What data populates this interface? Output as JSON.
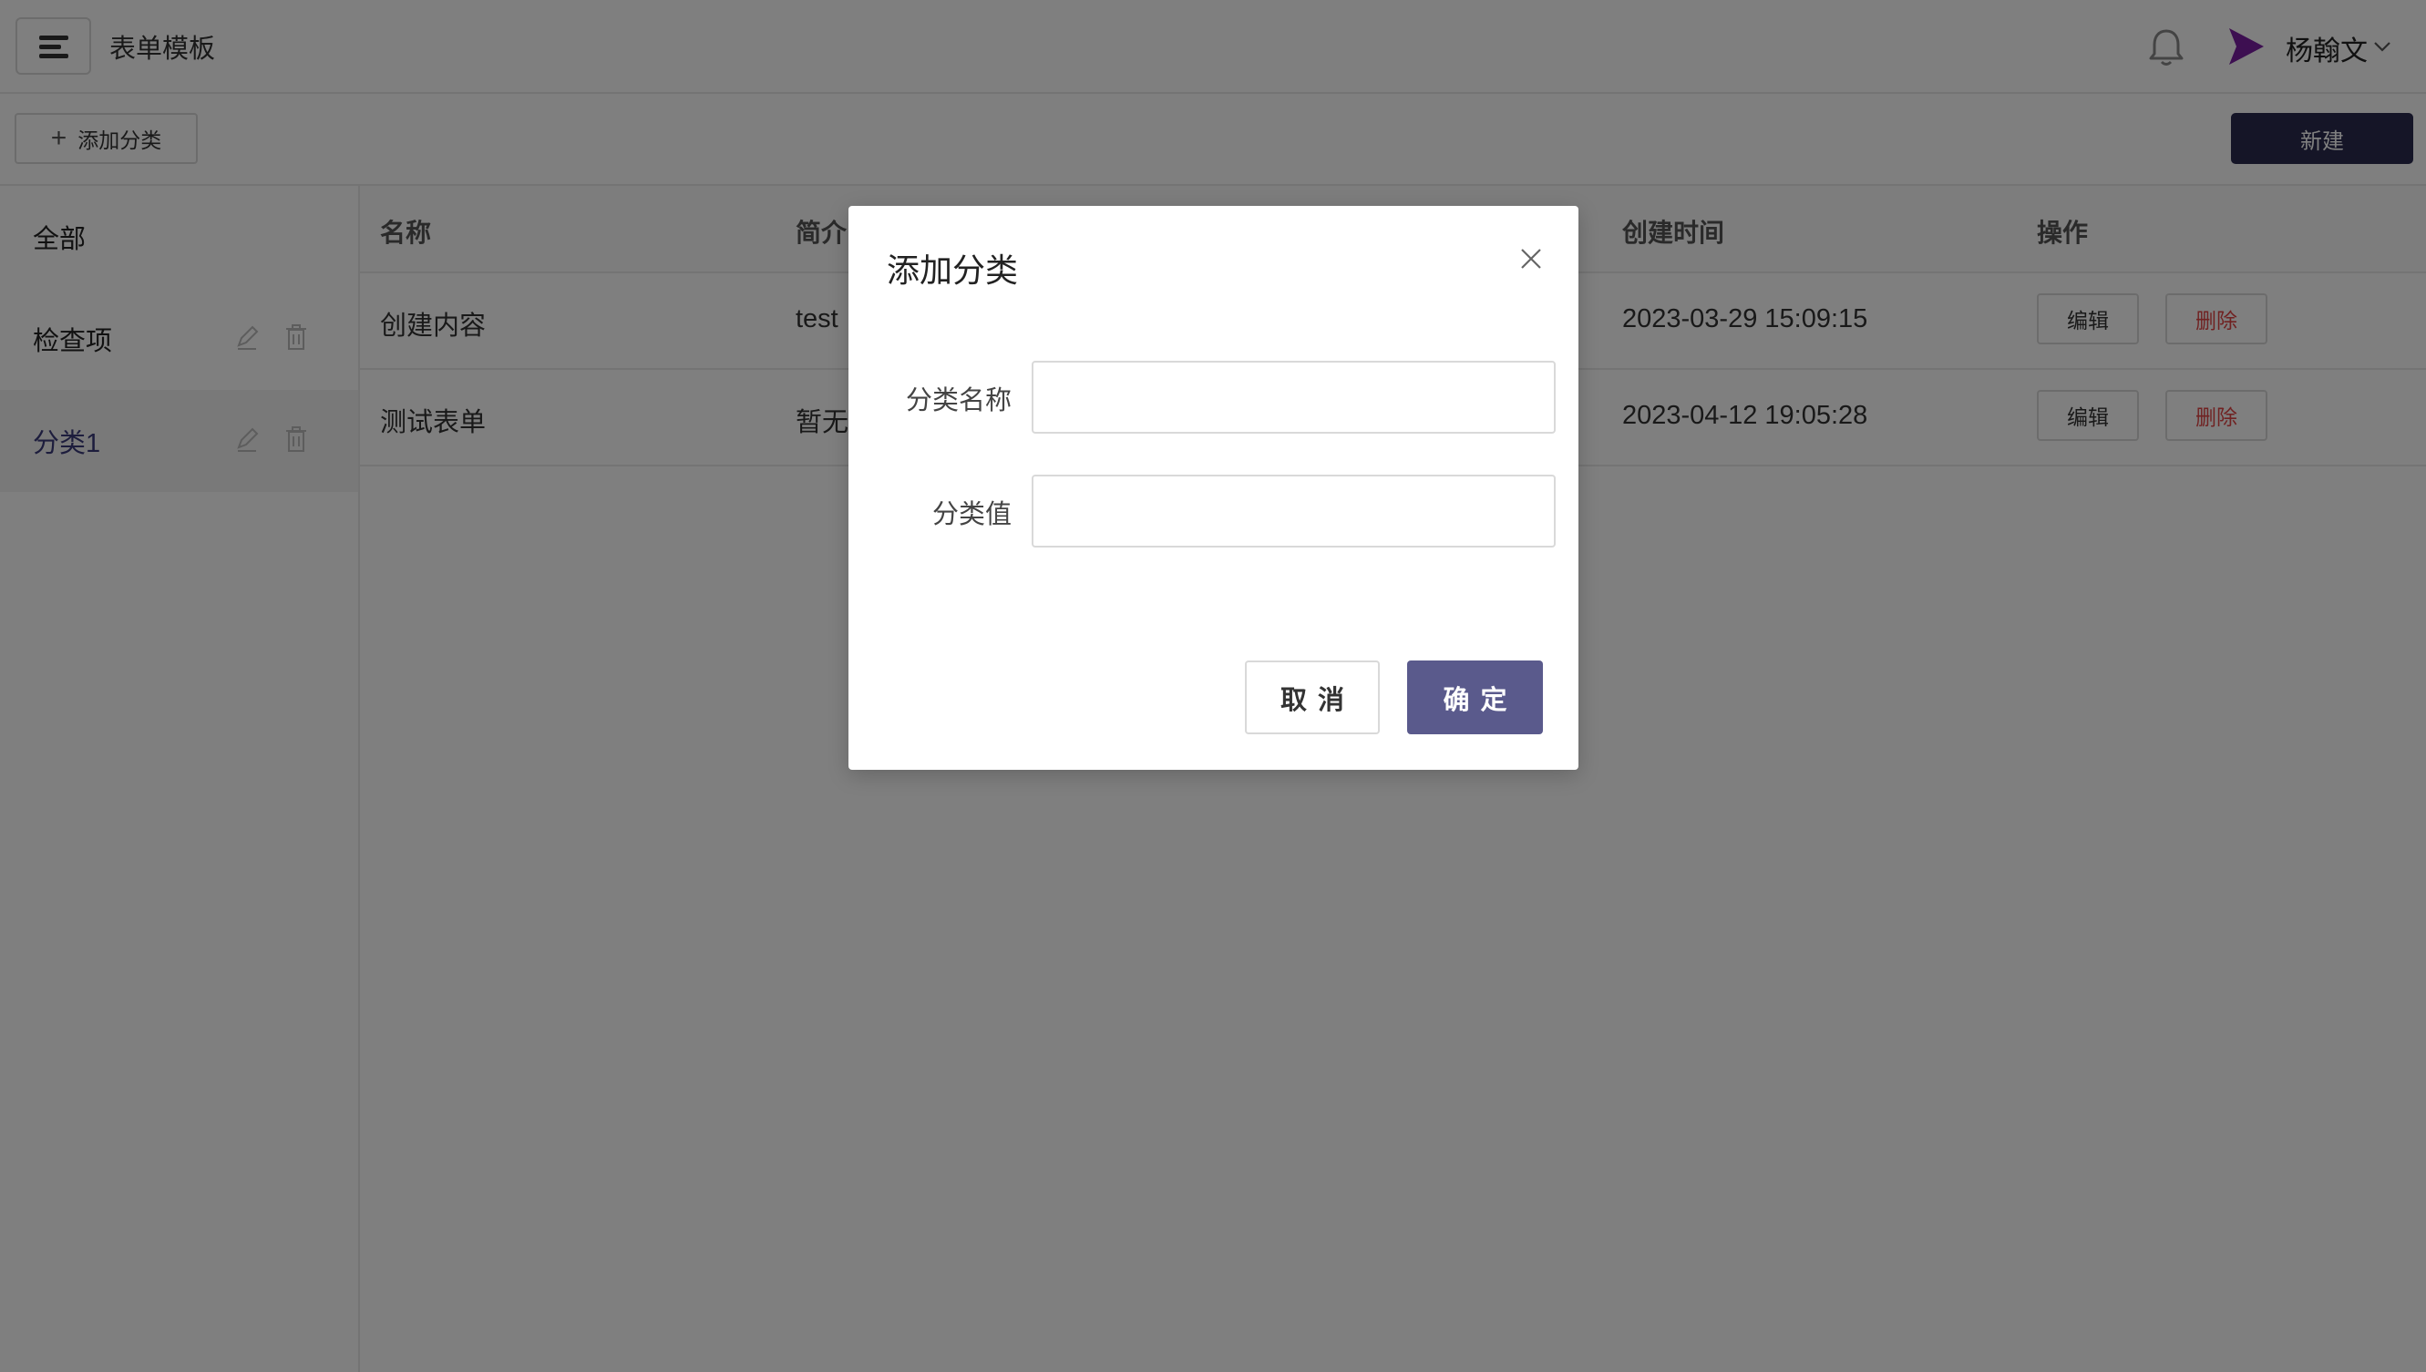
{
  "header": {
    "title": "表单模板",
    "user_name": "杨翰文"
  },
  "toolbar": {
    "add_category_label": "添加分类",
    "new_label": "新建"
  },
  "sidebar": {
    "items": [
      {
        "label": "全部"
      },
      {
        "label": "检查项"
      },
      {
        "label": "分类1"
      }
    ]
  },
  "table": {
    "columns": [
      "名称",
      "简介",
      "创建时间",
      "操作"
    ],
    "rows": [
      {
        "name": "创建内容",
        "desc": "test",
        "created": "2023-03-29 15:09:15"
      },
      {
        "name": "测试表单",
        "desc": "暂无",
        "created": "2023-04-12 19:05:28"
      }
    ],
    "edit_label": "编辑",
    "delete_label": "删除"
  },
  "modal": {
    "title": "添加分类",
    "name_label": "分类名称",
    "name_value": "",
    "value_label": "分类值",
    "value_value": "",
    "cancel_label": "取消",
    "ok_label": "确定"
  },
  "colors": {
    "primary": "#2b2b4f",
    "primary_button": "#5a5a8c",
    "danger": "#e04545",
    "logo": "#7a1fa2"
  }
}
